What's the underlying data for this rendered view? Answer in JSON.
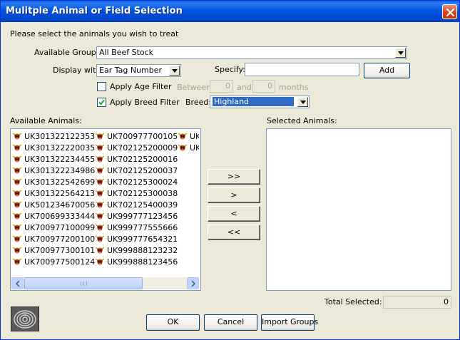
{
  "window": {
    "title": "Mulitple Animal or Field Selection"
  },
  "instruction": "Please select the animals you wish to treat",
  "groups": {
    "label": "Available Groups:",
    "value": "All Beef Stock"
  },
  "display": {
    "label": "Display with:",
    "value": "Ear Tag Number"
  },
  "specify": {
    "label": "Specify:",
    "value": "",
    "add_label": "Add"
  },
  "age_filter": {
    "label": "Apply Age Filter",
    "checked": false,
    "between_label": "Between",
    "from": "0",
    "and_label": "and",
    "to": "0",
    "months_label": "months"
  },
  "breed_filter": {
    "label": "Apply Breed Filter",
    "checked": true,
    "breed_label": "Breed:",
    "value": "Highland"
  },
  "available": {
    "label": "Available Animals:",
    "items": [
      "UK301322122353",
      "UK301322220035",
      "UK301322234455",
      "UK301322234986",
      "UK301322542699",
      "UK301322564213",
      "UK501234670056",
      "UK700699333444",
      "UK700977100099",
      "UK700977200100",
      "UK700977300101",
      "UK700977500124",
      "UK700977700105",
      "UK702125200009",
      "UK702125200016",
      "UK702125200037",
      "UK702125300024",
      "UK702125300038",
      "UK702125400039",
      "UK999777123456",
      "UK999777555666",
      "UK999777654321",
      "UK999888123232",
      "UK999888123456",
      "UK",
      "UK"
    ]
  },
  "selected": {
    "label": "Selected Animals:",
    "items": []
  },
  "move_buttons": {
    "add_all": ">>",
    "add": ">",
    "remove": "<",
    "remove_all": "<<"
  },
  "total": {
    "label": "Total Selected:",
    "value": "0"
  },
  "footer": {
    "ok": "OK",
    "cancel": "Cancel",
    "import": "Import Groups"
  },
  "colors": {
    "title_bar": "#0054e3",
    "dialog_bg": "#ece9d8",
    "selection": "#316ac5",
    "close": "#d5421f"
  },
  "icons": {
    "animal": "cow-head-icon",
    "close": "close-icon",
    "logo": "fingerprint-logo"
  }
}
